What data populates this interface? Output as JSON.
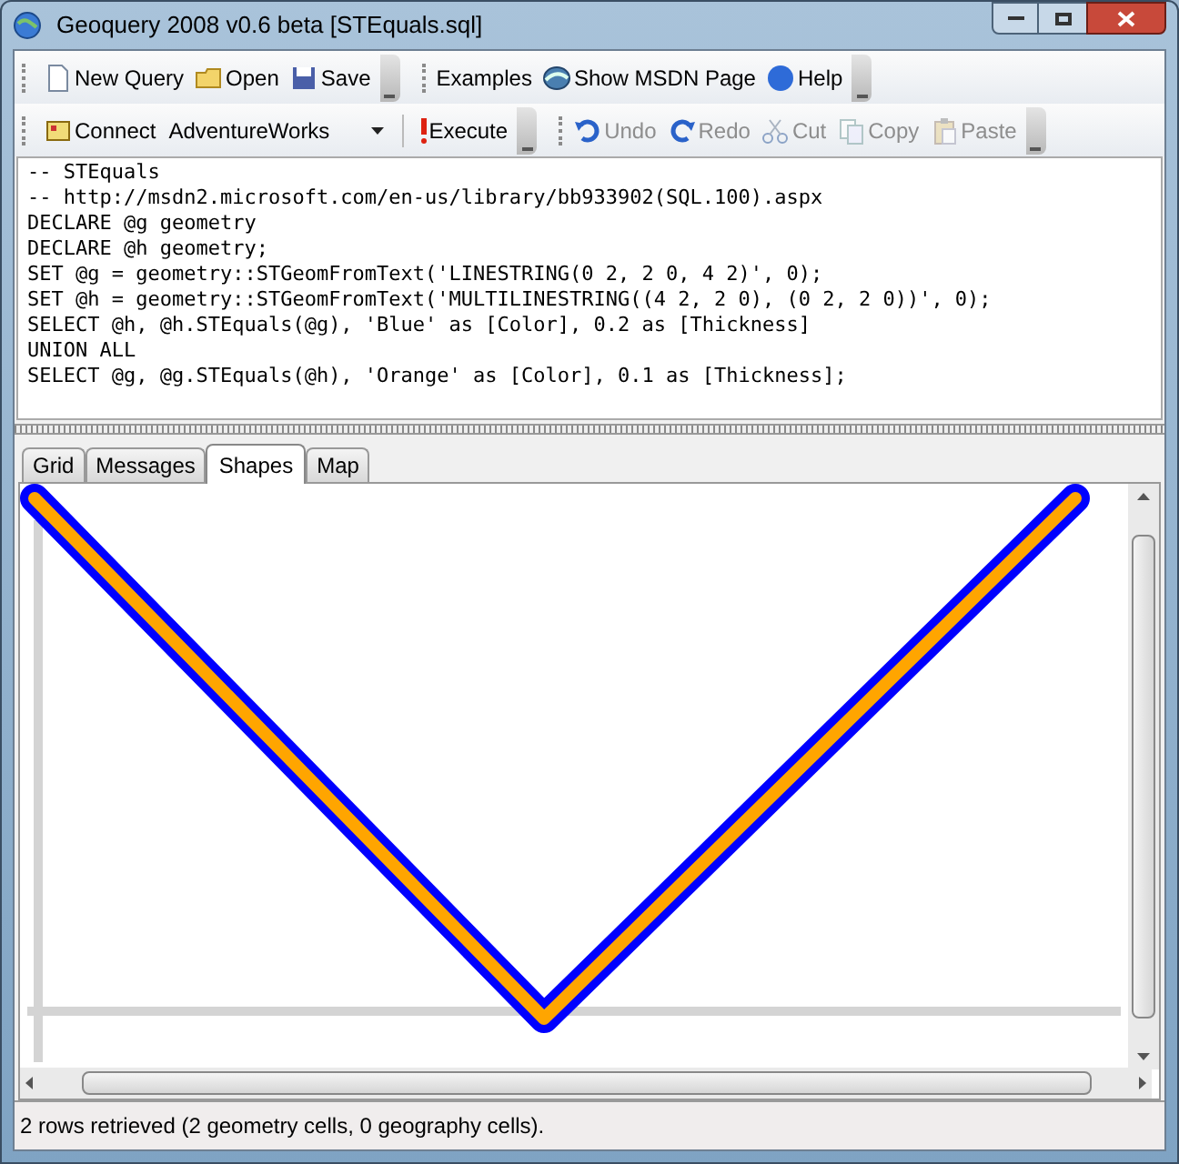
{
  "window": {
    "title": "Geoquery 2008 v0.6 beta [STEquals.sql]"
  },
  "toolbar_1": [
    {
      "kind": "button",
      "label": "New Query",
      "disabled": false
    },
    {
      "kind": "button",
      "label": "Open",
      "disabled": false
    },
    {
      "kind": "button",
      "label": "Save",
      "disabled": false
    },
    {
      "kind": "overflow"
    },
    {
      "kind": "button",
      "label": "Examples",
      "disabled": false
    },
    {
      "kind": "button",
      "label": "Show MSDN Page",
      "disabled": false
    },
    {
      "kind": "button",
      "label": "Help",
      "disabled": false
    },
    {
      "kind": "overflow"
    }
  ],
  "toolbar_2": [
    {
      "kind": "button",
      "label": "Connect",
      "disabled": false
    },
    {
      "kind": "dropdown",
      "value": "AdventureWorks"
    },
    {
      "kind": "button",
      "label": "Execute",
      "disabled": false
    },
    {
      "kind": "overflow"
    },
    {
      "kind": "button",
      "label": "Undo",
      "disabled": true
    },
    {
      "kind": "button",
      "label": "Redo",
      "disabled": true
    },
    {
      "kind": "button",
      "label": "Cut",
      "disabled": true
    },
    {
      "kind": "button",
      "label": "Copy",
      "disabled": true
    },
    {
      "kind": "button",
      "label": "Paste",
      "disabled": true
    },
    {
      "kind": "overflow"
    }
  ],
  "editor": {
    "lines": [
      "-- STEquals",
      "-- http://msdn2.microsoft.com/en-us/library/bb933902(SQL.100).aspx",
      "DECLARE @g geometry",
      "DECLARE @h geometry;",
      "SET @g = geometry::STGeomFromText('LINESTRING(0 2, 2 0, 4 2)', 0);",
      "SET @h = geometry::STGeomFromText('MULTILINESTRING((4 2, 2 0), (0 2, 2 0))', 0);",
      "SELECT @h, @h.STEquals(@g), 'Blue' as [Color], 0.2 as [Thickness]",
      "UNION ALL",
      "SELECT @g, @g.STEquals(@h), 'Orange' as [Color], 0.1 as [Thickness];"
    ]
  },
  "tabs": [
    {
      "label": "Grid",
      "selected": false
    },
    {
      "label": "Messages",
      "selected": false
    },
    {
      "label": "Shapes",
      "selected": true
    },
    {
      "label": "Map",
      "selected": false
    }
  ],
  "shapes": [
    {
      "color": "#0000ff"
    },
    {
      "color": "#ffa500"
    }
  ],
  "status_bar": {
    "text": "2 rows retrieved (2 geometry cells, 0 geography cells)."
  }
}
